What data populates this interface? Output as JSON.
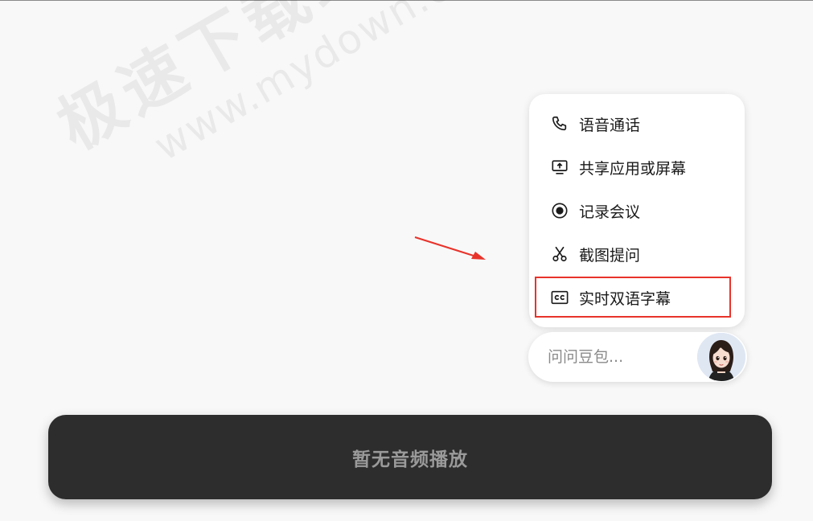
{
  "watermark": {
    "site_cn": "极速下载站",
    "site_url": "www.mydown.com"
  },
  "menu": {
    "items": [
      {
        "label": "语音通话",
        "icon": "phone-icon"
      },
      {
        "label": "共享应用或屏幕",
        "icon": "share-screen-icon"
      },
      {
        "label": "记录会议",
        "icon": "record-icon"
      },
      {
        "label": "截图提问",
        "icon": "scissors-icon"
      },
      {
        "label": "实时双语字幕",
        "icon": "cc-icon"
      }
    ]
  },
  "ask": {
    "placeholder": "问问豆包..."
  },
  "player": {
    "status_text": "暂无音频播放"
  },
  "colors": {
    "highlight": "#e8332b",
    "arrow": "#e8332b",
    "player_bg": "#2d2d2d"
  }
}
